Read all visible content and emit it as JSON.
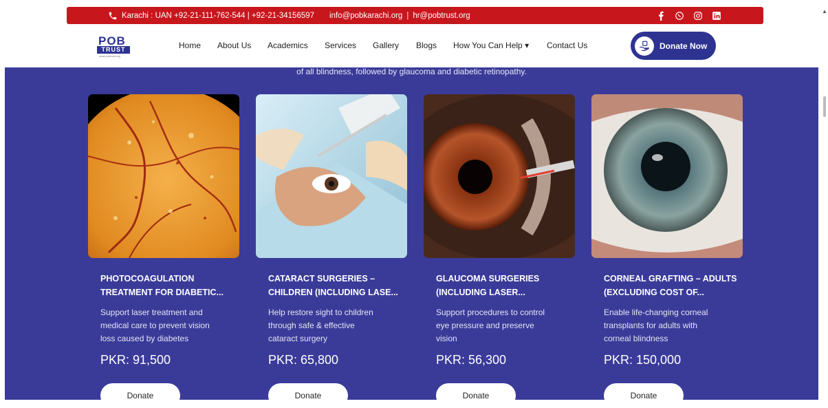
{
  "topbar": {
    "location": "Karachi : UAN +92-21-111-762-544 | +92-21-34156597",
    "email1": "info@pobkarachi.org",
    "separator": "|",
    "email2": "hr@pobtrust.org",
    "social_icons": [
      "facebook-icon",
      "whatsapp-icon",
      "instagram-icon",
      "linkedin-icon"
    ],
    "color": "#c8161d"
  },
  "nav": {
    "logo_top": "POB",
    "logo_bottom": "TRUST",
    "logo_url": "www.pobtrust.org",
    "items": [
      "Home",
      "About Us",
      "Academics",
      "Services",
      "Gallery",
      "Blogs",
      "How You Can Help ▾",
      "Contact Us"
    ],
    "donate_label": "Donate Now"
  },
  "main": {
    "intro": "of all blindness, followed by glaucoma and diabetic retinopathy.",
    "background": "#3a3b99"
  },
  "cards": [
    {
      "title": "PHOTOCOAGULATION\nTREATMENT FOR DIABETIC...",
      "desc": "Support laser treatment and\nmedical care to prevent vision\nloss caused by diabetes",
      "price": "PKR: 91,500",
      "button": "Donate"
    },
    {
      "title": "CATARACT SURGERIES –\nCHILDREN (INCLUDING LASE...",
      "desc": "Help restore sight to children\nthrough safe & effective\ncataract surgery",
      "price": "PKR: 65,800",
      "button": "Donate"
    },
    {
      "title": "GLAUCOMA SURGERIES\n(INCLUDING LASER...",
      "desc": "Support procedures to control\neye pressure and preserve\nvision",
      "price": "PKR: 56,300",
      "button": "Donate"
    },
    {
      "title": "CORNEAL GRAFTING – ADULTS\n(EXCLUDING COST OF...",
      "desc": "Enable life-changing corneal\ntransplants for adults with\ncorneal blindness",
      "price": "PKR: 150,000",
      "button": "Donate"
    }
  ]
}
